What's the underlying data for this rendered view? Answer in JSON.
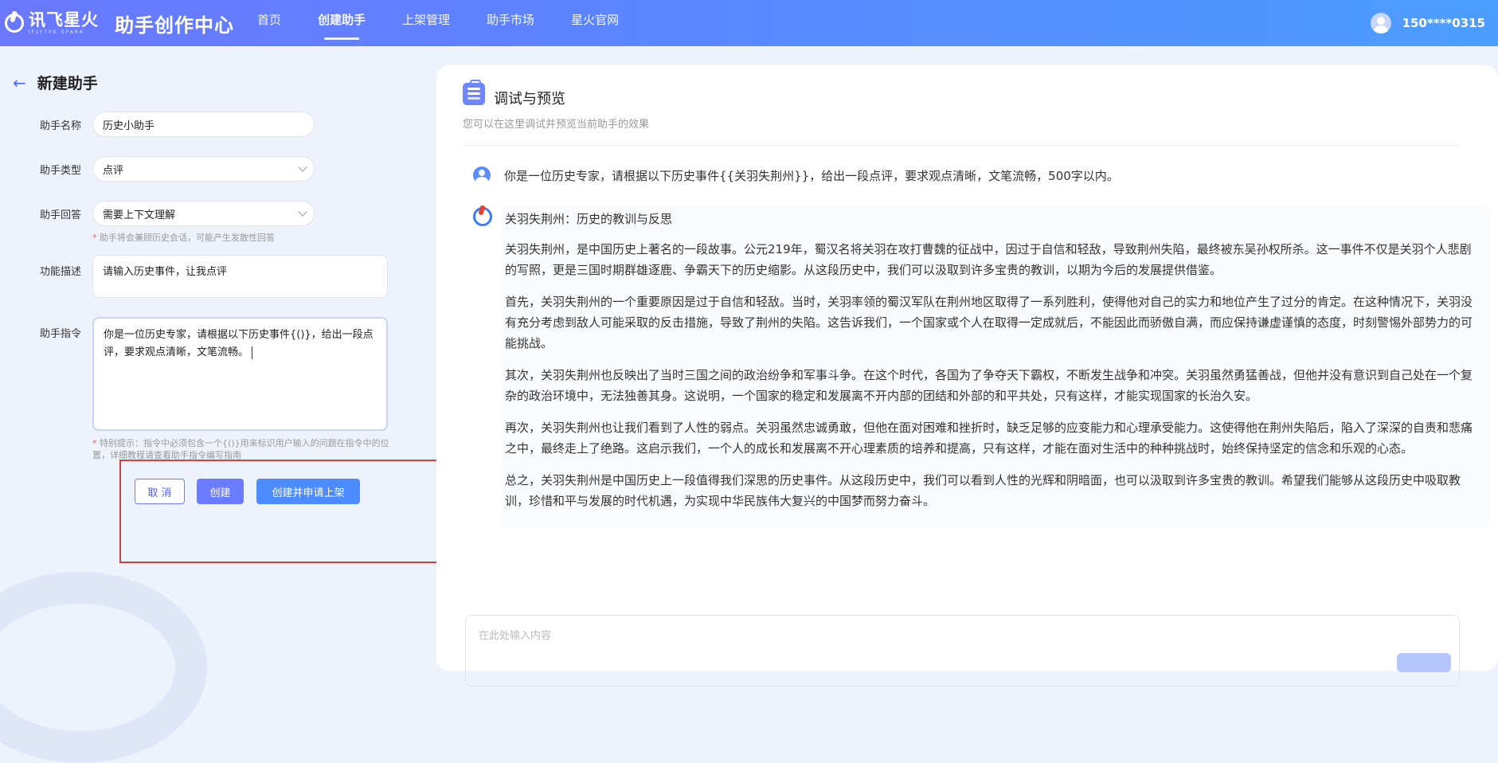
{
  "header": {
    "brand_cn": "讯飞星火",
    "brand_en": "IFLYTEK SPARK",
    "center_title": "助手创作中心",
    "nav": [
      {
        "label": "首页",
        "active": false
      },
      {
        "label": "创建助手",
        "active": true
      },
      {
        "label": "上架管理",
        "active": false
      },
      {
        "label": "助手市场",
        "active": false
      },
      {
        "label": "星火官网",
        "active": false
      }
    ],
    "user_phone": "150****0315"
  },
  "form": {
    "page_title": "新建助手",
    "name_label": "助手名称",
    "name_value": "历史小助手",
    "type_label": "助手类型",
    "type_value": "点评",
    "reply_label": "助手回答",
    "reply_value": "需要上下文理解",
    "reply_hint": "助手将会兼顾历史会话，可能产生发散性回答",
    "desc_label": "功能描述",
    "desc_value": "请输入历史事件，让我点评",
    "cmd_label": "助手指令",
    "cmd_value": "你是一位历史专家，请根据以下历史事件{()}，给出一段点评，要求观点清晰，文笔流畅。",
    "cmd_hint": "特别提示：指令中必须包含一个{()}用来标识用户输入的问题在指令中的位置，详细教程请查看助手指令编写指南",
    "cancel_label": "取 消",
    "create_label": "创建",
    "submit_label": "创建并申请上架"
  },
  "preview": {
    "title": "调试与预览",
    "subtitle": "您可以在这里调试并预览当前助手的效果",
    "user_message": "你是一位历史专家，请根据以下历史事件{{关羽失荆州}}，给出一段点评，要求观点清晰，文笔流畅，500字以内。",
    "reply_title": "关羽失荆州：历史的教训与反思",
    "reply_paragraphs": [
      "关羽失荆州，是中国历史上著名的一段故事。公元219年，蜀汉名将关羽在攻打曹魏的征战中，因过于自信和轻敌，导致荆州失陷，最终被东吴孙权所杀。这一事件不仅是关羽个人悲剧的写照，更是三国时期群雄逐鹿、争霸天下的历史缩影。从这段历史中，我们可以汲取到许多宝贵的教训，以期为今后的发展提供借鉴。",
      "首先，关羽失荆州的一个重要原因是过于自信和轻敌。当时，关羽率领的蜀汉军队在荆州地区取得了一系列胜利，使得他对自己的实力和地位产生了过分的肯定。在这种情况下，关羽没有充分考虑到敌人可能采取的反击措施，导致了荆州的失陷。这告诉我们，一个国家或个人在取得一定成就后，不能因此而骄傲自满，而应保持谦虚谨慎的态度，时刻警惕外部势力的可能挑战。",
      "其次，关羽失荆州也反映出了当时三国之间的政治纷争和军事斗争。在这个时代，各国为了争夺天下霸权，不断发生战争和冲突。关羽虽然勇猛善战，但他并没有意识到自己处在一个复杂的政治环境中，无法独善其身。这说明，一个国家的稳定和发展离不开内部的团结和外部的和平共处，只有这样，才能实现国家的长治久安。",
      "再次，关羽失荆州也让我们看到了人性的弱点。关羽虽然忠诚勇敢，但他在面对困难和挫折时，缺乏足够的应变能力和心理承受能力。这使得他在荆州失陷后，陷入了深深的自责和悲痛之中，最终走上了绝路。这启示我们，一个人的成长和发展离不开心理素质的培养和提高，只有这样，才能在面对生活中的种种挑战时，始终保持坚定的信念和乐观的心态。",
      "总之，关羽失荆州是中国历史上一段值得我们深思的历史事件。从这段历史中，我们可以看到人性的光辉和阴暗面，也可以汲取到许多宝贵的教训。希望我们能够从这段历史中吸取教训，珍惜和平与发展的时代机遇，为实现中华民族伟大复兴的中国梦而努力奋斗。"
    ],
    "input_placeholder": "在此处输入内容"
  },
  "colors": {
    "accent": "#6b7cff",
    "primary": "#4d8cff",
    "highlight_box": "#e53935"
  }
}
